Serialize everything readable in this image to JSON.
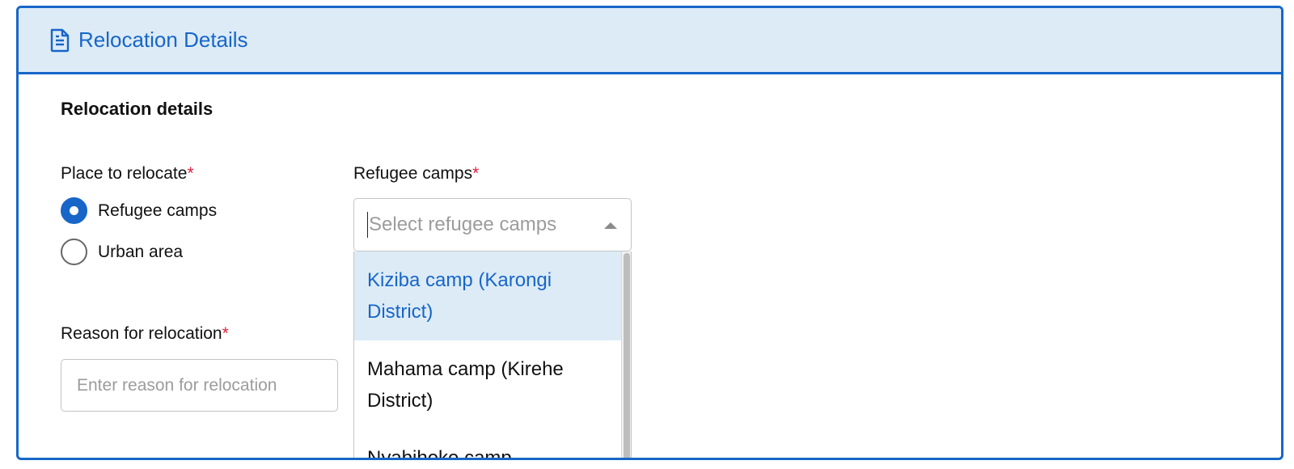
{
  "panel": {
    "header_title": "Relocation Details",
    "header_icon": "document-icon"
  },
  "form": {
    "section_title": "Relocation details",
    "place_label": "Place to relocate",
    "required_mark": "*",
    "place_options": [
      {
        "label": "Refugee camps",
        "checked": true
      },
      {
        "label": "Urban area",
        "checked": false
      }
    ],
    "camps_label": "Refugee camps",
    "camps_placeholder": "Select refugee camps",
    "camps_options": [
      {
        "label": "Kiziba camp (Karongi District)",
        "highlighted": true
      },
      {
        "label": "Mahama camp (Kirehe District)",
        "highlighted": false
      },
      {
        "label": "Nyabiheke camp",
        "highlighted": false
      }
    ],
    "reason_label": "Reason for relocation",
    "reason_placeholder": "Enter reason for relocation"
  },
  "colors": {
    "accent": "#1766c8",
    "header_bg": "#ddebf7",
    "required": "#e0203a"
  }
}
